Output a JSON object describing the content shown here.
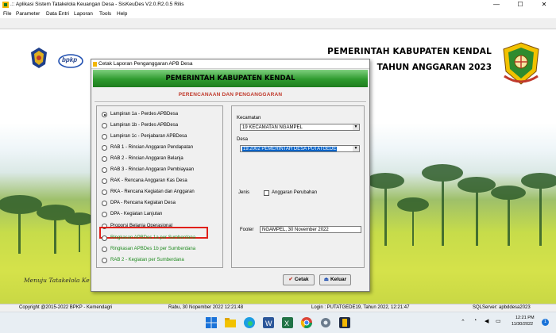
{
  "window": {
    "title": ".:: Aplikasi Sistem Tatakelola Keuangan Desa - SisKeuDes V2.0.R2.0.5 Rilis",
    "controls": [
      "—",
      "☐",
      "✕"
    ]
  },
  "menu": [
    "File",
    "Parameter",
    "Data Entri",
    "Laporan",
    "Tools",
    "Help"
  ],
  "header": {
    "line1": "PEMERINTAH KABUPATEN KENDAL",
    "line2": "TAHUN ANGGARAN 2023",
    "logo_text": "bpkp"
  },
  "slogan": "Menuju Tatakelola Ke",
  "dialog": {
    "title": "Cetak Laporan Penganggaran APB Desa",
    "banner": "PEMERINTAH KABUPATEN KENDAL",
    "subtitle": "PERENCANAAN DAN PENGANGGARAN",
    "options": [
      {
        "label": "Lampiran 1a - Perdes  APBDesa",
        "selected": true,
        "color": "black"
      },
      {
        "label": "Lampiran 1b - Perdes APBDesa",
        "selected": false,
        "color": "black"
      },
      {
        "label": "Lampiran 1c - Penjabaran APBDesa",
        "selected": false,
        "color": "black"
      },
      {
        "label": "RAB 1 - Rincian Anggaran Pendapatan",
        "selected": false,
        "color": "black"
      },
      {
        "label": "RAB 2 - Rincian Anggaran Belanja",
        "selected": false,
        "color": "black"
      },
      {
        "label": "RAB 3 - Rincian Anggaran Pembiayaan",
        "selected": false,
        "color": "black"
      },
      {
        "label": "RAK - Rencana Anggaran Kas Desa",
        "selected": false,
        "color": "black"
      },
      {
        "label": "RKA - Rencana Kegiatan dan Anggaran",
        "selected": false,
        "color": "black"
      },
      {
        "label": "DPA - Rencana Kegiatan Desa",
        "selected": false,
        "color": "black"
      },
      {
        "label": "DPA - Kegiatan Lanjutan",
        "selected": false,
        "color": "black"
      },
      {
        "label": "Proporsi Belanja Operasional",
        "selected": false,
        "color": "black"
      },
      {
        "label": "Ringkasan APBDes 1a per Sumberdana",
        "selected": false,
        "color": "green"
      },
      {
        "label": "Ringkasan APBDes 1b per Sumberdana",
        "selected": false,
        "color": "green"
      },
      {
        "label": "RAB 2 - Kegiatan per Sumberdana",
        "selected": false,
        "color": "green"
      }
    ],
    "kecamatan_label": "Kecamatan",
    "kecamatan_value": "19  KECAMATAN NGAMPEL",
    "desa_label": "Desa",
    "desa_value": "19.2002   PEMERINTAH DESA PUTATGEDE",
    "jenis_label": "Jenis",
    "jenis_checkbox_label": "Anggaran Perubahan",
    "jenis_checked": false,
    "footer_label": "Footer",
    "footer_value": "NGAMPEL,  30 November 2022",
    "cetak_label": "Cetak",
    "keluar_label": "Keluar"
  },
  "statusbar": {
    "copyright": "Copyright @2015-2022 BPKP - Kemendagri",
    "datetime": "Rabu, 30 Nopember 2022  12:21:48",
    "login": "Login : PUTATGEDE19,  Tahun 2022,  12:21:47",
    "server": "SQLServer: apbddesa2023"
  },
  "taskbar": {
    "time": "12:21 PM",
    "date": "11/30/2022",
    "notification_count": "1"
  },
  "colors": {
    "banner_green": "#2e9a2e",
    "subtitle_red": "#c0392b",
    "highlight_red": "#e0201a",
    "selection_blue": "#0a64c8"
  }
}
